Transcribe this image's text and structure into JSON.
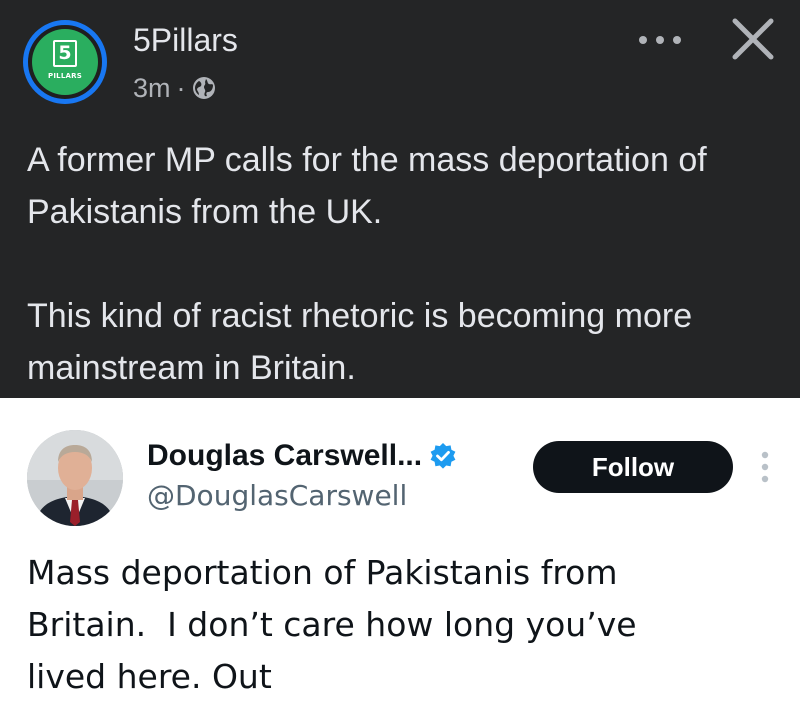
{
  "facebook_post": {
    "page_name": "5Pillars",
    "avatar_logo_number": "5",
    "avatar_logo_word": "PILLARS",
    "time": "3m",
    "separator": "·",
    "privacy_icon": "globe-icon",
    "more_icon": "more-horizontal-icon",
    "close_icon": "close-icon",
    "paragraphs": [
      "A former MP calls for the mass deportation of Pakistanis from the UK.",
      "This kind of racist rhetoric is becoming more mainstream in Britain."
    ],
    "colors": {
      "background": "#242526",
      "text": "#e4e6eb",
      "avatar_ring": "#1877f2",
      "avatar_fill": "#2aae5f"
    }
  },
  "embedded_tweet": {
    "display_name": "Douglas Carswell...",
    "handle": "@DouglasCarswell",
    "verified_icon": "verified-badge-icon",
    "follow_label": "Follow",
    "more_icon": "more-vertical-icon",
    "text_lines": [
      "Mass deportation of Pakistanis from",
      "Britain.  I don’t care how long you’ve",
      "lived here. Out"
    ],
    "colors": {
      "verified": "#1d9bf0",
      "follow_bg": "#0f1419",
      "handle": "#536471"
    }
  }
}
